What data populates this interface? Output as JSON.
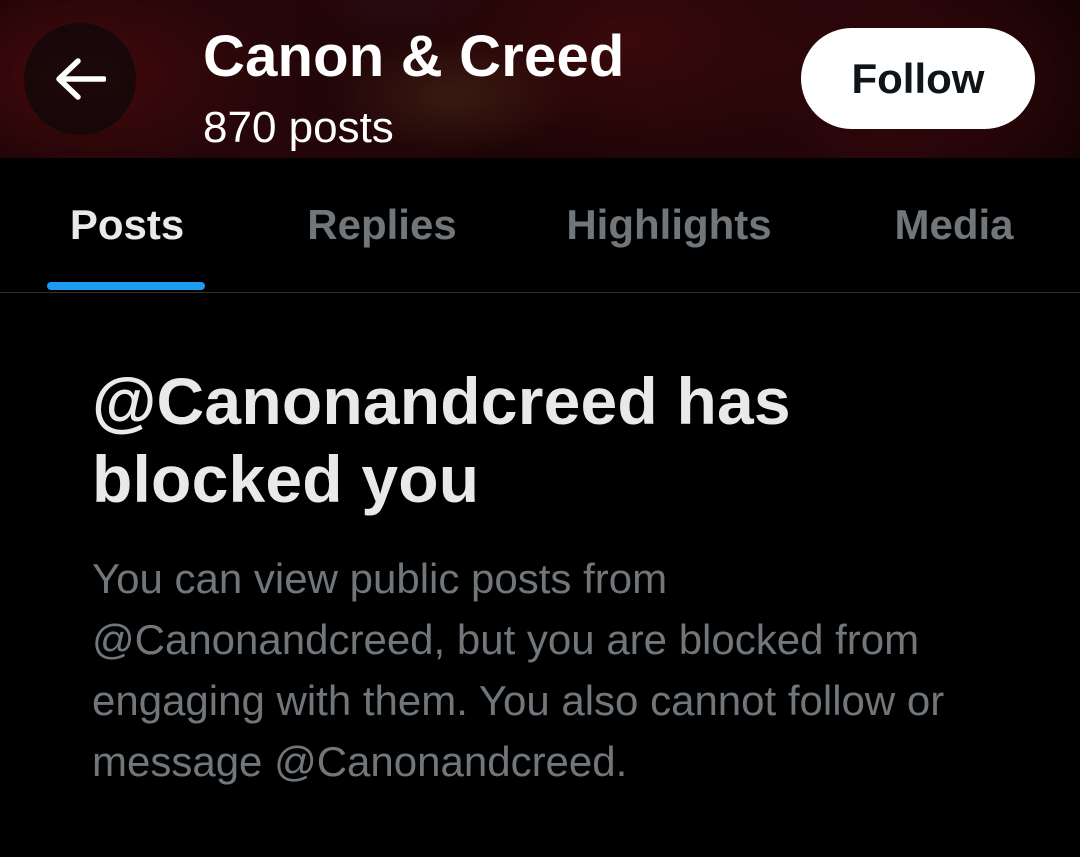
{
  "header": {
    "back_icon": "arrow-left-icon",
    "profile_name": "Canon & Creed",
    "post_count": "870 posts",
    "follow_label": "Follow"
  },
  "tabs": [
    {
      "label": "Posts",
      "active": true
    },
    {
      "label": "Replies",
      "active": false
    },
    {
      "label": "Highlights",
      "active": false
    },
    {
      "label": "Media",
      "active": false
    }
  ],
  "notice": {
    "title": "@Canonandcreed has blocked you",
    "body": "You can view public posts from @Canonandcreed, but you are blocked from engaging with them. You also cannot follow or message @Canonandcreed."
  },
  "colors": {
    "background": "#000000",
    "primary_text": "#e7e9ea",
    "secondary_text": "#71767b",
    "accent": "#1d9bf0",
    "divider": "#2f3336",
    "follow_button_bg": "#ffffff",
    "follow_button_text": "#0f1419"
  }
}
